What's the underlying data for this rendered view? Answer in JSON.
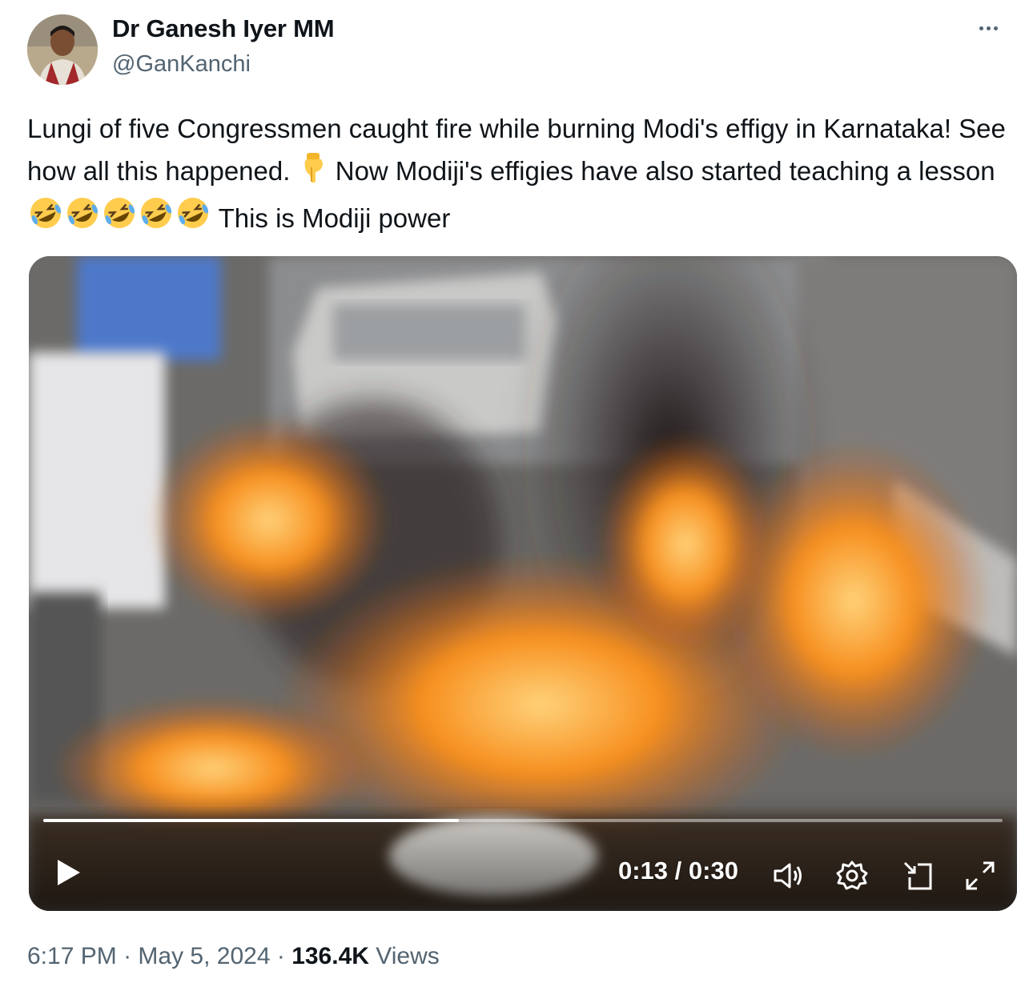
{
  "author": {
    "name": "Dr Ganesh Iyer MM",
    "handle": "@GanKanchi"
  },
  "tweet": {
    "text_part1": "Lungi of five Congressmen caught fire while burning Modi's effigy in Karnataka! See how all this happened. ",
    "text_part2": " Now Modiji's effigies have also started teaching a lesson ",
    "text_part3": " This is Modiji power",
    "emoji_pointing": "backhand-index-pointing-down",
    "emoji_laughing": "rolling-on-the-floor-laughing",
    "emoji_laughing_count": 5
  },
  "video": {
    "time_display": "0:13 / 0:30",
    "progress": 0.4333,
    "icons": [
      "play-icon",
      "volume-icon",
      "settings-icon",
      "dock-icon",
      "fullscreen-icon"
    ]
  },
  "meta": {
    "time": "6:17 PM",
    "separator": " · ",
    "date": "May 5, 2024",
    "views_count": "136.4K",
    "views_label": "Views"
  },
  "colors": {
    "text_primary": "#0f1419",
    "text_secondary": "#536471",
    "fire_orange": "#f57d1e"
  }
}
